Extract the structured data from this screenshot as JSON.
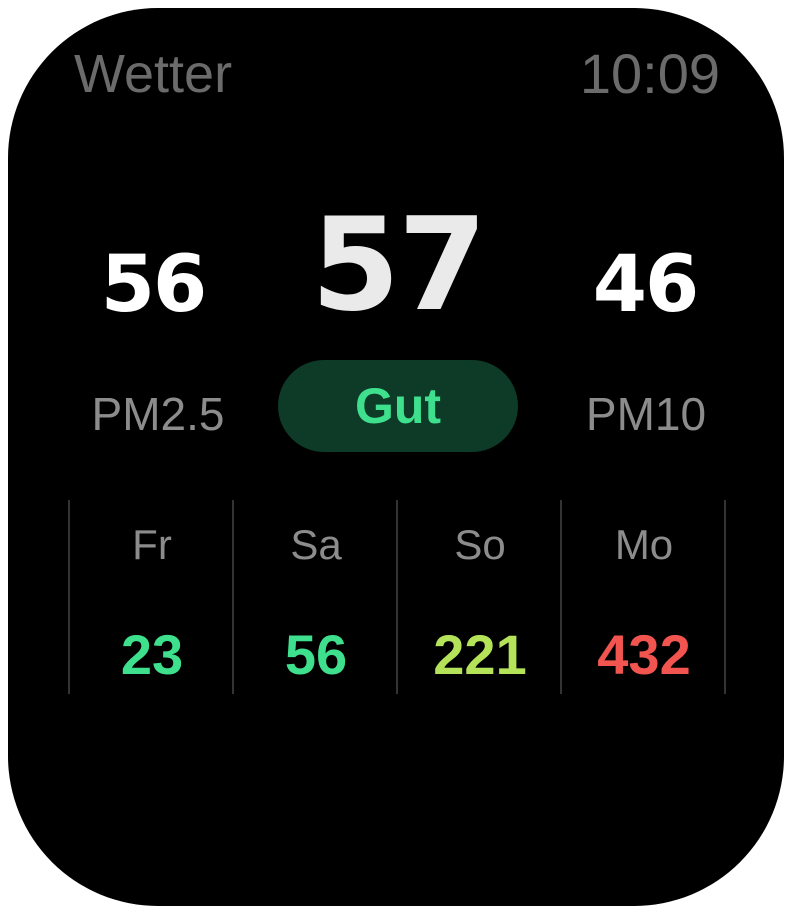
{
  "header": {
    "app_title": "Wetter",
    "time": "10:09"
  },
  "aqi": {
    "pm25_value": "56",
    "main_value": "57",
    "pm10_value": "46",
    "pm25_label": "PM2.5",
    "pm10_label": "PM10",
    "status": "Gut",
    "status_color": "#3ee08d",
    "status_bg": "#0e3a28"
  },
  "forecast": [
    {
      "day": "Fr",
      "value": "23",
      "color": "#3ee08d"
    },
    {
      "day": "Sa",
      "value": "56",
      "color": "#3ee08d"
    },
    {
      "day": "So",
      "value": "221",
      "color": "#b4e35a"
    },
    {
      "day": "Mo",
      "value": "432",
      "color": "#f2554f"
    }
  ]
}
